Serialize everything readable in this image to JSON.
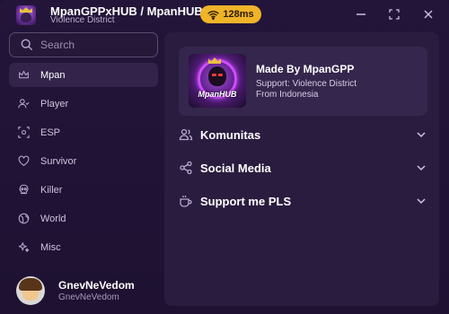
{
  "window": {
    "title": "MpanGPPxHUB / MpanHUB",
    "subtitle": "Violence District",
    "ping": "128ms",
    "icons": [
      "app-logo",
      "wifi-icon",
      "minimize-icon",
      "maximize-icon",
      "close-icon"
    ]
  },
  "search": {
    "placeholder": "Search"
  },
  "sidebar": {
    "items": [
      {
        "label": "Mpan",
        "icon": "crown-icon",
        "active": true
      },
      {
        "label": "Player",
        "icon": "user-icon"
      },
      {
        "label": "ESP",
        "icon": "eye-icon"
      },
      {
        "label": "Survivor",
        "icon": "heart-icon"
      },
      {
        "label": "Killer",
        "icon": "skull-icon"
      },
      {
        "label": "World",
        "icon": "globe-icon"
      },
      {
        "label": "Misc",
        "icon": "sparkle-icon"
      }
    ]
  },
  "user": {
    "display_name": "GnevNeVedom",
    "username": "GnevNeVedom"
  },
  "profile": {
    "title": "Made By MpanGPP",
    "line1": "Support: Violence District",
    "line2": "From Indonesia",
    "logo_text": "MpanHUB"
  },
  "sections": [
    {
      "label": "Komunitas",
      "icon": "users-icon"
    },
    {
      "label": "Social Media",
      "icon": "share-icon"
    },
    {
      "label": "Support me PLS",
      "icon": "coffee-icon"
    }
  ],
  "colors": {
    "accent": "#f0b429",
    "background": "#1f1230",
    "panel": "#2a1c3f"
  }
}
